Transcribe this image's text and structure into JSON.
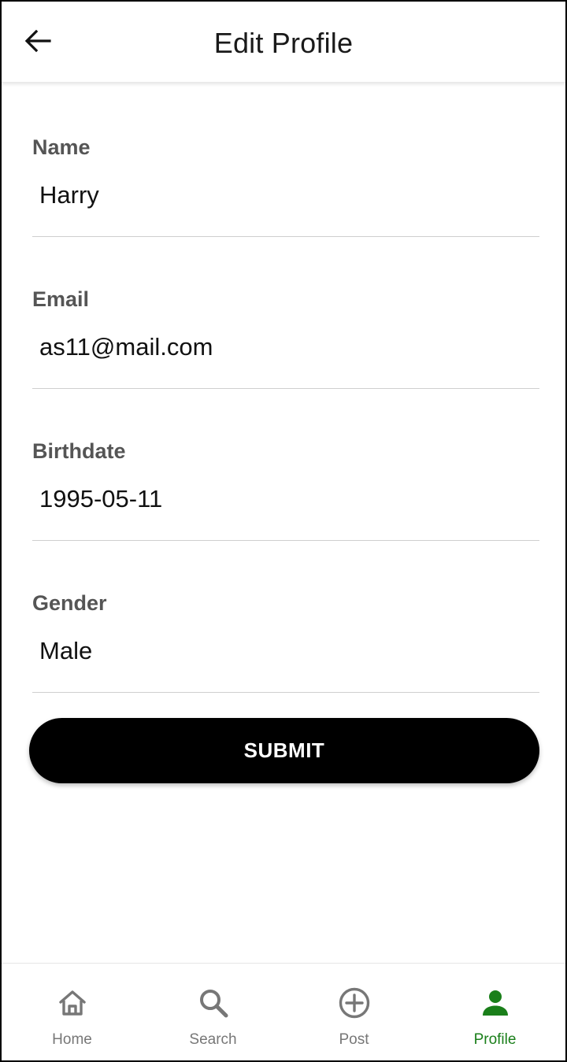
{
  "header": {
    "title": "Edit Profile",
    "back_icon": "arrow-left-icon"
  },
  "form": {
    "fields": [
      {
        "label": "Name",
        "value": "Harry"
      },
      {
        "label": "Email",
        "value": "as11@mail.com"
      },
      {
        "label": "Birthdate",
        "value": "1995-05-11"
      },
      {
        "label": "Gender",
        "value": "Male"
      }
    ],
    "submit_label": "SUBMIT"
  },
  "bottom_nav": {
    "items": [
      {
        "label": "Home",
        "icon": "home-icon",
        "active": false
      },
      {
        "label": "Search",
        "icon": "search-icon",
        "active": false
      },
      {
        "label": "Post",
        "icon": "add-circle-icon",
        "active": false
      },
      {
        "label": "Profile",
        "icon": "person-icon",
        "active": true
      }
    ]
  },
  "colors": {
    "accent_active": "#1a7f1a",
    "inactive": "#777777",
    "button_bg": "#000000",
    "button_text": "#ffffff",
    "label": "#555555"
  }
}
